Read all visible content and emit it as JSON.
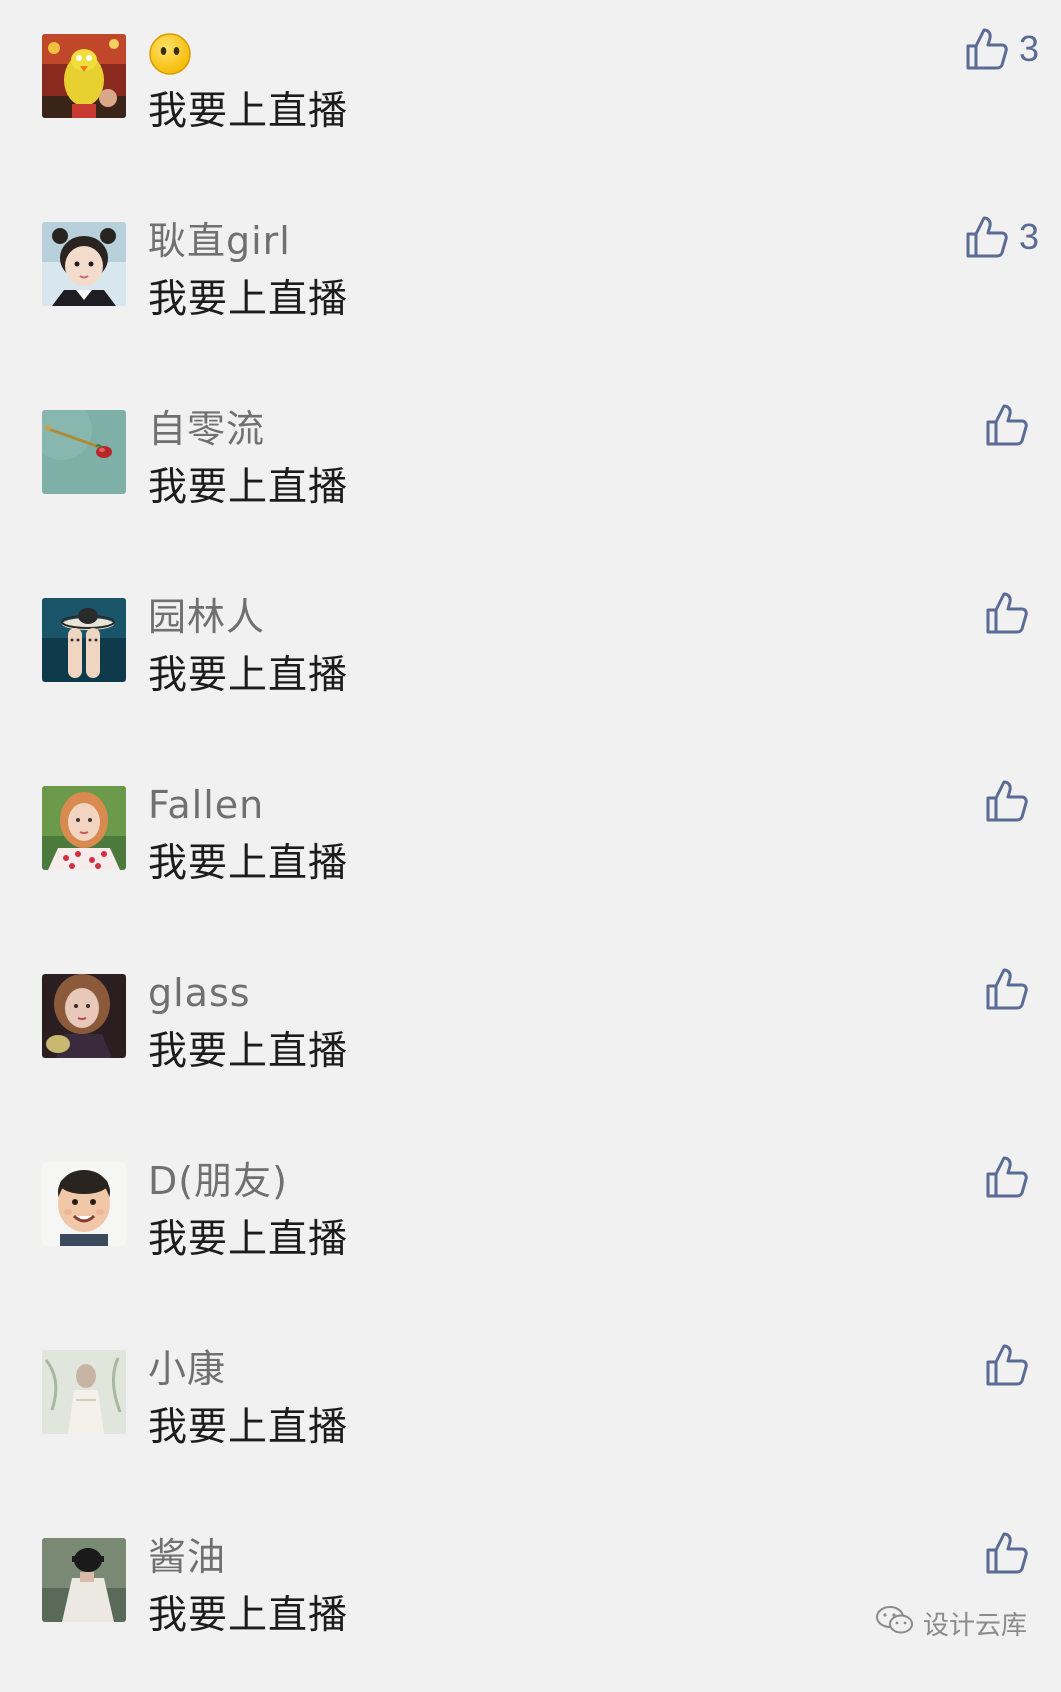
{
  "colors": {
    "background": "#f1f1f1",
    "username": "#707070",
    "content": "#1c1c1c",
    "like_icon": "#5a6b95"
  },
  "comments": [
    {
      "username": "",
      "username_emoji": "neutral-face-emoji",
      "content": "我要上直播",
      "likes": "3",
      "avatar": "sesame-yellow-bird"
    },
    {
      "username": "耿直girl",
      "content": "我要上直播",
      "likes": "3",
      "avatar": "little-girl"
    },
    {
      "username": "自零流",
      "content": "我要上直播",
      "likes": "",
      "avatar": "teal-pin"
    },
    {
      "username": "园林人",
      "content": "我要上直播",
      "likes": "",
      "avatar": "finger-hats"
    },
    {
      "username": "Fallen",
      "content": "我要上直播",
      "likes": "",
      "avatar": "redhead-girl"
    },
    {
      "username": "glass",
      "content": "我要上直播",
      "likes": "",
      "avatar": "doll-girl"
    },
    {
      "username": "D(朋友)",
      "content": "我要上直播",
      "likes": "",
      "avatar": "smiling-boy"
    },
    {
      "username": "小康",
      "content": "我要上直播",
      "likes": "",
      "avatar": "white-figure"
    },
    {
      "username": "酱油",
      "content": "我要上直播",
      "likes": "",
      "avatar": "person-hat"
    }
  ],
  "watermark": {
    "icon": "wechat-icon",
    "text": "设计云库"
  }
}
